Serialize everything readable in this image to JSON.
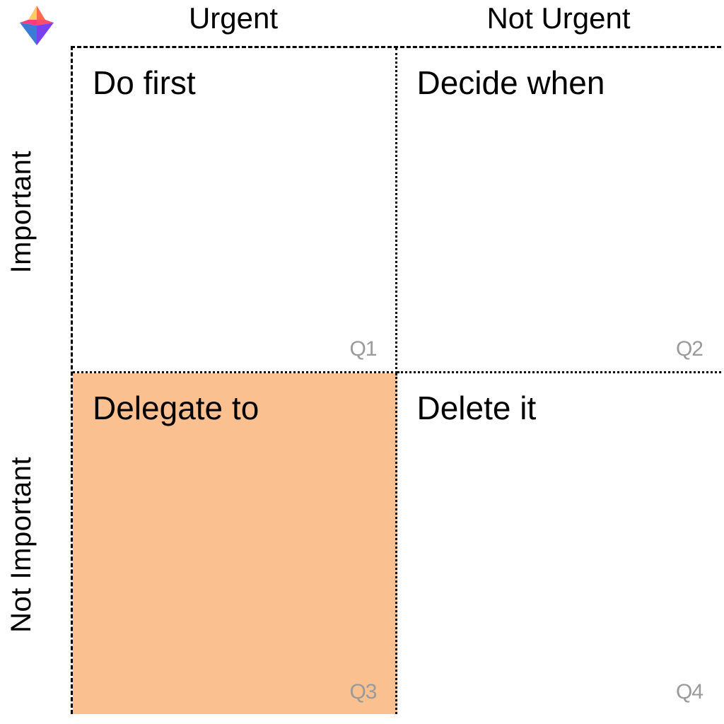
{
  "columns": {
    "left": "Urgent",
    "right": "Not Urgent"
  },
  "rows": {
    "top": "Important",
    "bottom": "Not Important"
  },
  "quadrants": {
    "q1": {
      "title": "Do first",
      "code": "Q1"
    },
    "q2": {
      "title": "Decide when",
      "code": "Q2"
    },
    "q3": {
      "title": "Delegate to",
      "code": "Q3"
    },
    "q4": {
      "title": "Delete it",
      "code": "Q4"
    }
  },
  "highlighted_quadrant": "q3",
  "colors": {
    "highlight": "#fac090",
    "code_text": "#9a9a9a"
  }
}
